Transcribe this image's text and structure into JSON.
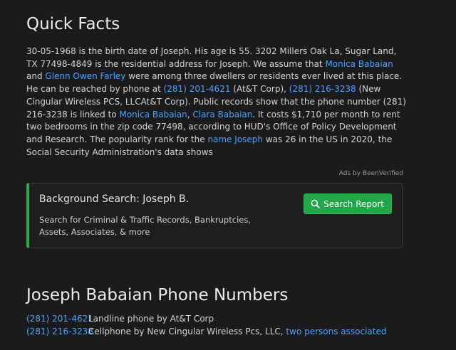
{
  "quick_facts": {
    "title": "Quick Facts",
    "p1": "30-05-1968 is the birth date of Joseph. His age is 55. 3202 Millers Oak La, Sugar Land, TX 77498-4849 is the residential address for Joseph. We assume that ",
    "link_monica": "Monica Babaian",
    "p2": " and ",
    "link_glenn": "Glenn Owen Farley",
    "p3": " were among three dwellers or residents ever lived at this place. He can be reached by phone at ",
    "link_phone1": "(281) 201-4621",
    "p4": " (At&T Corp), ",
    "link_phone2": "(281) 216-3238",
    "p5": " (New Cingular Wireless PCS, LLCAt&T Corp). Public records show that the phone number (281) 216-3238 is linked to ",
    "link_monica2": "Monica Babaian",
    "p6": ", ",
    "link_clara": "Clara Babaian",
    "p7": ". It costs $1,710 per month to rent two bedrooms in the zip code 77498, according to HUD's Office of Policy Development and Research. The popularity rank for the ",
    "link_name": "name Joseph",
    "p8": " was 26 in the US in 2020, the Social Security Administration's data shows"
  },
  "ads": {
    "label": "Ads by BeenVerified",
    "title": "Background Search: Joseph B.",
    "description": "Search for Criminal & Traffic Records, Bankruptcies, Assets, Associates, & more",
    "button_label": "Search Report",
    "accent_color": "#23a54a"
  },
  "phone_numbers": {
    "title": "Joseph Babaian Phone Numbers",
    "rows": [
      {
        "number": "(281) 201-4621",
        "description": "Landline phone by At&T Corp",
        "link": ""
      },
      {
        "number": "(281) 216-3238",
        "description": "Cellphone by New Cingular Wireless Pcs, LLC, ",
        "link": "two persons associated"
      }
    ]
  },
  "colors": {
    "background": "#1b1b1d",
    "link": "#4aa3ff",
    "text": "#d4d4d4"
  }
}
